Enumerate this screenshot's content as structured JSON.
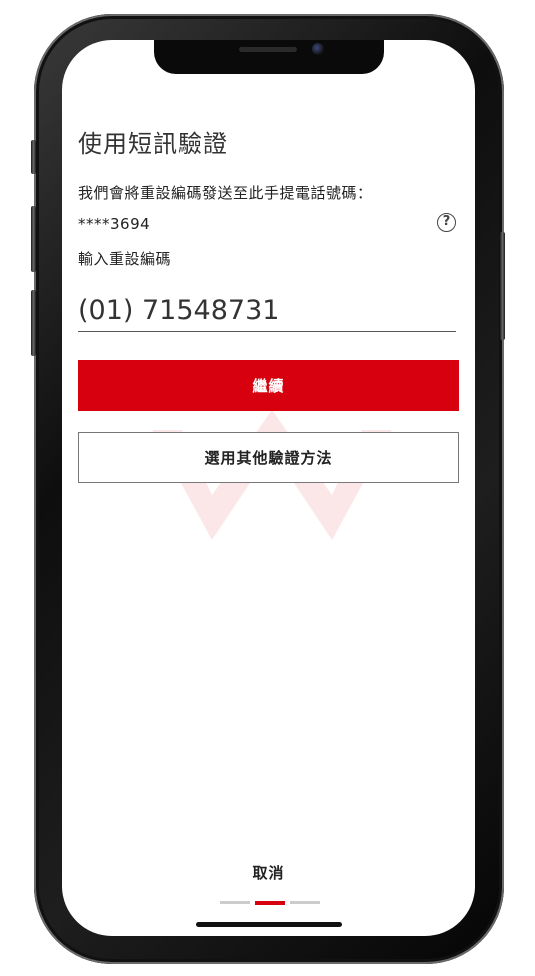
{
  "screen": {
    "title": "使用短訊驗證",
    "description": "我們會將重設編碼發送至此手提電話號碼：",
    "masked_phone": "****3694",
    "help_icon": "question-circle-icon",
    "code_label": "輸入重設編碼",
    "code_value": "(01) 71548731",
    "continue_label": "繼續",
    "other_method_label": "選用其他驗證方法",
    "cancel_label": "取消",
    "steps": {
      "total": 3,
      "current": 2
    }
  },
  "colors": {
    "accent": "#d7000f",
    "text": "#222222",
    "step_inactive": "#cccccc"
  }
}
